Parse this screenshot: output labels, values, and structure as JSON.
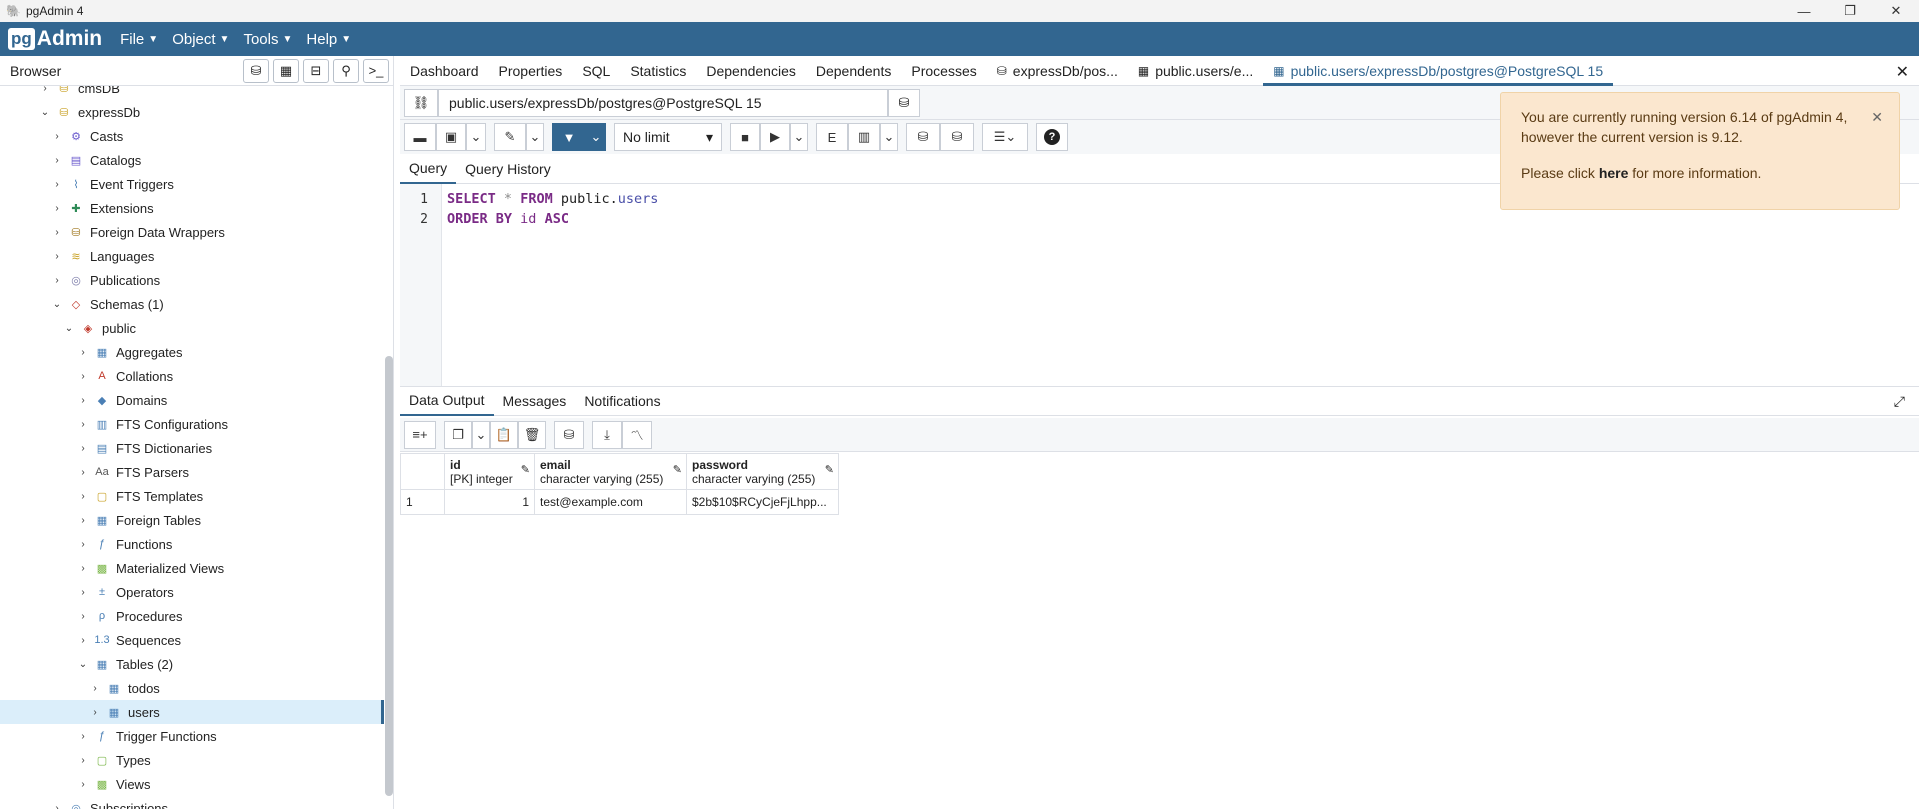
{
  "window": {
    "title": "pgAdmin 4",
    "minimize": "—",
    "maximize": "❐",
    "close": "✕"
  },
  "menubar": {
    "logo_pg": "pg",
    "logo_admin": "Admin",
    "items": [
      "File",
      "Object",
      "Tools",
      "Help"
    ]
  },
  "browser": {
    "title": "Browser",
    "tree": [
      {
        "label": "cmsDB",
        "level": 0,
        "icon": "database-icon",
        "state": "collapsed"
      },
      {
        "label": "expressDb",
        "level": 0,
        "icon": "database-icon",
        "state": "expanded"
      },
      {
        "label": "Casts",
        "level": 1,
        "icon": "casts-icon",
        "state": "collapsed"
      },
      {
        "label": "Catalogs",
        "level": 1,
        "icon": "catalogs-icon",
        "state": "collapsed"
      },
      {
        "label": "Event Triggers",
        "level": 1,
        "icon": "event-triggers-icon",
        "state": "collapsed"
      },
      {
        "label": "Extensions",
        "level": 1,
        "icon": "extensions-icon",
        "state": "collapsed"
      },
      {
        "label": "Foreign Data Wrappers",
        "level": 1,
        "icon": "foreign-data-wrappers-icon",
        "state": "collapsed"
      },
      {
        "label": "Languages",
        "level": 1,
        "icon": "languages-icon",
        "state": "collapsed"
      },
      {
        "label": "Publications",
        "level": 1,
        "icon": "publications-icon",
        "state": "collapsed"
      },
      {
        "label": "Schemas (1)",
        "level": 1,
        "icon": "schemas-icon",
        "state": "expanded"
      },
      {
        "label": "public",
        "level": 2,
        "icon": "schema-icon",
        "state": "expanded"
      },
      {
        "label": "Aggregates",
        "level": 3,
        "icon": "aggregates-icon",
        "state": "collapsed"
      },
      {
        "label": "Collations",
        "level": 3,
        "icon": "collations-icon",
        "state": "collapsed"
      },
      {
        "label": "Domains",
        "level": 3,
        "icon": "domains-icon",
        "state": "collapsed"
      },
      {
        "label": "FTS Configurations",
        "level": 3,
        "icon": "fts-configurations-icon",
        "state": "collapsed"
      },
      {
        "label": "FTS Dictionaries",
        "level": 3,
        "icon": "fts-dictionaries-icon",
        "state": "collapsed"
      },
      {
        "label": "FTS Parsers",
        "level": 3,
        "icon": "fts-parsers-icon",
        "state": "collapsed"
      },
      {
        "label": "FTS Templates",
        "level": 3,
        "icon": "fts-templates-icon",
        "state": "collapsed"
      },
      {
        "label": "Foreign Tables",
        "level": 3,
        "icon": "foreign-tables-icon",
        "state": "collapsed"
      },
      {
        "label": "Functions",
        "level": 3,
        "icon": "functions-icon",
        "state": "collapsed"
      },
      {
        "label": "Materialized Views",
        "level": 3,
        "icon": "materialized-views-icon",
        "state": "collapsed"
      },
      {
        "label": "Operators",
        "level": 3,
        "icon": "operators-icon",
        "state": "collapsed"
      },
      {
        "label": "Procedures",
        "level": 3,
        "icon": "procedures-icon",
        "state": "collapsed"
      },
      {
        "label": "Sequences",
        "level": 3,
        "icon": "sequences-icon",
        "state": "collapsed"
      },
      {
        "label": "Tables (2)",
        "level": 3,
        "icon": "tables-icon",
        "state": "expanded"
      },
      {
        "label": "todos",
        "level": 4,
        "icon": "table-icon",
        "state": "collapsed"
      },
      {
        "label": "users",
        "level": 4,
        "icon": "table-icon",
        "state": "collapsed",
        "selected": true
      },
      {
        "label": "Trigger Functions",
        "level": 3,
        "icon": "trigger-functions-icon",
        "state": "collapsed"
      },
      {
        "label": "Types",
        "level": 3,
        "icon": "types-icon",
        "state": "collapsed"
      },
      {
        "label": "Views",
        "level": 3,
        "icon": "views-icon",
        "state": "collapsed"
      },
      {
        "label": "Subscriptions",
        "level": 1,
        "icon": "subscriptions-icon",
        "state": "collapsed"
      }
    ]
  },
  "tabs": [
    {
      "label": "Dashboard"
    },
    {
      "label": "Properties"
    },
    {
      "label": "SQL"
    },
    {
      "label": "Statistics"
    },
    {
      "label": "Dependencies"
    },
    {
      "label": "Dependents"
    },
    {
      "label": "Processes"
    },
    {
      "label": "expressDb/pos...",
      "icon": "database-icon"
    },
    {
      "label": "public.users/e...",
      "icon": "table-icon"
    },
    {
      "label": "public.users/expressDb/postgres@PostgreSQL 15",
      "icon": "table-icon",
      "active": true
    }
  ],
  "query_tool": {
    "connection": "public.users/expressDb/postgres@PostgreSQL 15",
    "limit": "No limit",
    "tabs": [
      "Query",
      "Query History"
    ],
    "lines": [
      "1",
      "2"
    ],
    "sql_line1": {
      "kw1": "SELECT",
      "op": "*",
      "kw2": "FROM",
      "schema": "public",
      "dot": ".",
      "table": "users"
    },
    "sql_line2": {
      "kw1": "ORDER BY",
      "field": "id",
      "kw2": "ASC"
    }
  },
  "output": {
    "tabs": [
      "Data Output",
      "Messages",
      "Notifications"
    ],
    "columns": [
      {
        "name": "id",
        "type": "[PK] integer"
      },
      {
        "name": "email",
        "type": "character varying (255)"
      },
      {
        "name": "password",
        "type": "character varying (255)"
      }
    ],
    "rows": [
      {
        "num": "1",
        "id": "1",
        "email": "test@example.com",
        "password": "$2b$10$RCyCjeFjLhpp..."
      }
    ]
  },
  "notification": {
    "line1": "You are currently running version 6.14 of pgAdmin 4,",
    "line2": "however the current version is 9.12.",
    "line3_pre": "Please click ",
    "line3_link": "here",
    "line3_post": " for more information."
  },
  "colors": {
    "brand": "#326690",
    "selected": "#dbeefa",
    "toast": "#fbe7cf"
  }
}
